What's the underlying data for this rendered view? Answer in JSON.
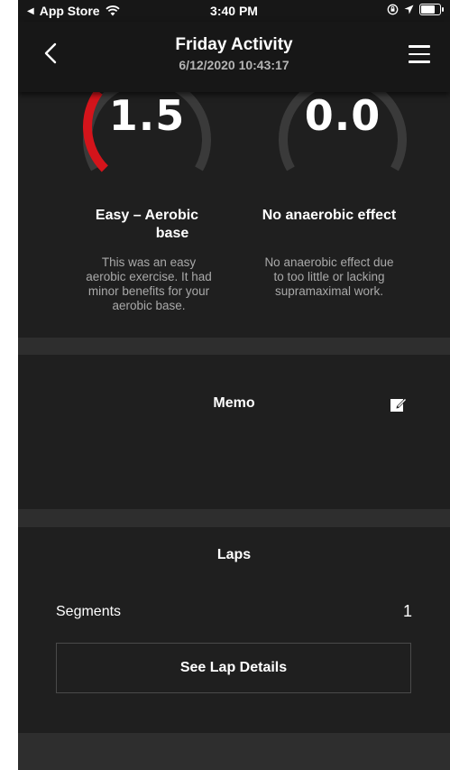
{
  "status_bar": {
    "back_app": "App Store",
    "time": "3:40 PM",
    "battery_level": 0.85
  },
  "header": {
    "title": "Friday Activity",
    "subtitle": "6/12/2020 10:43:17"
  },
  "training_effect": {
    "aerobic": {
      "value": "1.5",
      "level_fraction": 0.3,
      "title_line1": "Easy – Aerobic",
      "title_line2": "base",
      "description": [
        "This was an easy",
        "aerobic exercise. It had",
        "minor benefits for your",
        "aerobic base."
      ]
    },
    "anaerobic": {
      "value": "0.0",
      "level_fraction": 0.0,
      "title": "No anaerobic effect",
      "description": [
        "No anaerobic effect due",
        "to too little or lacking",
        "supramaximal work."
      ]
    },
    "colors": {
      "aerobic_arc": "#d4141b",
      "track": "#3a3a3a"
    }
  },
  "memo": {
    "title": "Memo"
  },
  "laps": {
    "title": "Laps",
    "segments_label": "Segments",
    "segments_value": "1",
    "details_button": "See Lap Details"
  },
  "icons": {
    "back": "chevron-left-icon",
    "menu": "hamburger-menu-icon",
    "edit": "edit-note-icon",
    "wifi": "wifi-icon",
    "location": "location-arrow-icon",
    "lock_rotation": "rotation-lock-icon",
    "battery": "battery-icon"
  }
}
